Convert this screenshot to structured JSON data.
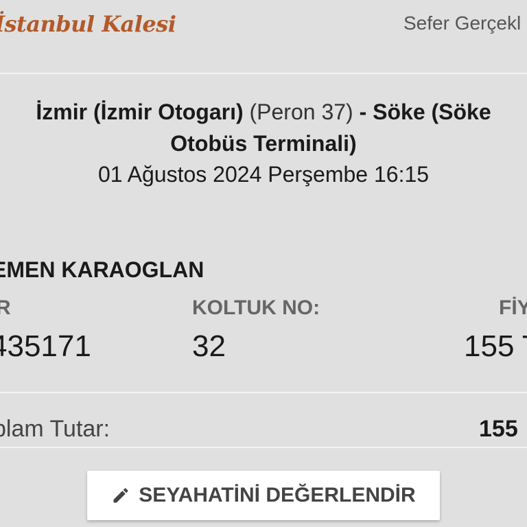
{
  "header": {
    "logo_text": "İstanbul Kalesi",
    "right_text": "Sefer Gerçekl"
  },
  "trip": {
    "origin": "İzmir (İzmir Otogarı)",
    "platform": "(Peron 37)",
    "destination_line1": "- Söke (Söke",
    "destination_line2": "Otobüs Terminali)",
    "datetime": "01 Ağustos 2024 Perşembe 16:15"
  },
  "passenger": {
    "name": "EMEN KARAOGLAN",
    "col1_label": "R",
    "col1_value": "435171",
    "seat_label": "KOLTUK NO:",
    "seat_value": "32",
    "price_label": "FİY",
    "price_value": "155 T"
  },
  "total": {
    "label": "plam Tutar:",
    "value": "155"
  },
  "actions": {
    "rate_label": "SEYAHATİNİ DEĞERLENDİR",
    "rate_icon": "pencil-icon"
  }
}
